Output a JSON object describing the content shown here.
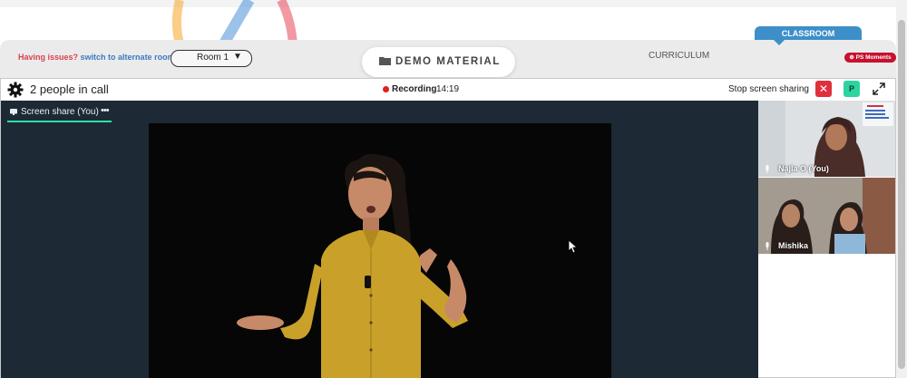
{
  "banner": {
    "issues_text": "Having issues?",
    "switch_text": "switch to alternate room",
    "room_select": "Room 1",
    "demo_material": "DEMO MATERIAL",
    "curriculum": "CURRICULUM",
    "classroom_tab": "CLASSROOM",
    "ps_badge": "PS Moments"
  },
  "call": {
    "people_count": "2 people in call",
    "recording_label": "Recording",
    "recording_time": "14:19",
    "stop_sharing": "Stop screen sharing",
    "p_button": "P"
  },
  "share_tab": {
    "label": "Screen share (You)",
    "more": "•••"
  },
  "participants": [
    {
      "name": "Najla O (You)"
    },
    {
      "name": "Mishika"
    }
  ],
  "colors": {
    "accent_blue": "#3d8fc9",
    "danger_red": "#e0303e",
    "recording_red": "#e02020",
    "green": "#2dd4a0",
    "stage_bg": "#1d2a35"
  }
}
